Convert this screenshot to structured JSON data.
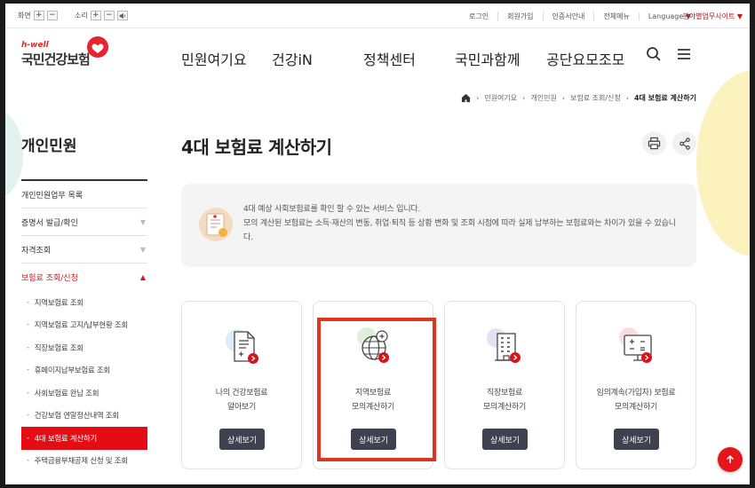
{
  "util": {
    "screen_label": "화면",
    "sound_label": "소리",
    "plus": "+",
    "minus": "−",
    "links": [
      "로그인",
      "회원가입",
      "인증서안내",
      "전체메뉴",
      "Language ▼"
    ],
    "dept": "분야별업무사이트 ▼"
  },
  "logo": {
    "hwell": "h-well",
    "name": "국민건강보험"
  },
  "gnb": [
    "민원여기요",
    "건강iN",
    "정책센터",
    "국민과함께",
    "공단요모조모"
  ],
  "breadcrumb": [
    "민원여기요",
    "개인민원",
    "보험료 조회/신청",
    "4대 보험료 계산하기"
  ],
  "sidebar": {
    "title": "개인민원",
    "items": [
      {
        "label": "개인민원업무 목록",
        "arrow": ""
      },
      {
        "label": "증명서 발급/확인",
        "arrow": "▼"
      },
      {
        "label": "자격조회",
        "arrow": "▼"
      },
      {
        "label": "보험료 조회/신청",
        "arrow": "▲"
      }
    ],
    "subs": [
      "지역보험료 조회",
      "지역보험료 고지/납부현황 조회",
      "직장보험료 조회",
      "휴페이지납부보험료 조회",
      "사회보험료 완납 조회",
      "건강보험 연말정산내역 조회",
      "4대 보험료 계산하기",
      "주택금융부채공제 신청 및 조회"
    ]
  },
  "main": {
    "title": "4대 보험료 계산하기",
    "info_lines": [
      "4대 예상 사회보험료를 확인 할 수 있는 서비스 입니다.",
      "모의 계산된 보험료는 소득·재산의 변동, 취업·퇴직 등 상황 변화 및 조회 시점에 따라 실제 납부하는 보험료와는 차이가 있을 수 있습니다."
    ],
    "cards": [
      {
        "line1": "나의 건강보험료",
        "line2": "알아보기",
        "button": "상세보기"
      },
      {
        "line1": "지역보험료",
        "line2": "모의계산하기",
        "button": "상세보기"
      },
      {
        "line1": "직장보험료",
        "line2": "모의계산하기",
        "button": "상세보기"
      },
      {
        "line1": "임의계속(가입자) 보험료",
        "line2": "모의계산하기",
        "button": "상세보기"
      }
    ]
  },
  "colors": {
    "accent": "#d41920",
    "button": "#3c4250",
    "highlight": "#d9371f"
  }
}
